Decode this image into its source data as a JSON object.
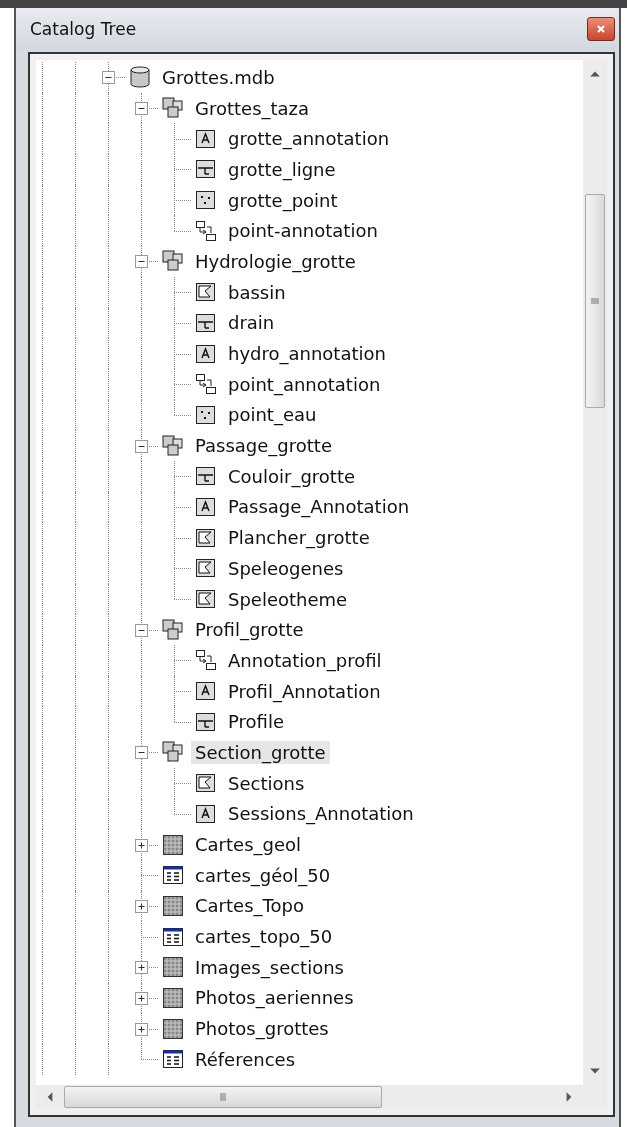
{
  "window": {
    "title": "Catalog Tree"
  },
  "tree": [
    {
      "label": "Grottes.mdb",
      "kind": "database",
      "expanded": true,
      "selected": false,
      "children": [
        {
          "label": "Grottes_taza",
          "kind": "dataset",
          "expanded": true,
          "selected": false,
          "children": [
            {
              "label": "grotte_annotation",
              "kind": "annotation",
              "selected": false
            },
            {
              "label": "grotte_ligne",
              "kind": "line",
              "selected": false
            },
            {
              "label": "grotte_point",
              "kind": "point",
              "selected": false
            },
            {
              "label": "point-annotation",
              "kind": "relationship",
              "selected": false
            }
          ]
        },
        {
          "label": "Hydrologie_grotte",
          "kind": "dataset",
          "expanded": true,
          "selected": false,
          "children": [
            {
              "label": "bassin",
              "kind": "polygon",
              "selected": false
            },
            {
              "label": "drain",
              "kind": "line",
              "selected": false
            },
            {
              "label": "hydro_annotation",
              "kind": "annotation",
              "selected": false
            },
            {
              "label": "point_annotation",
              "kind": "relationship",
              "selected": false
            },
            {
              "label": "point_eau",
              "kind": "point",
              "selected": false
            }
          ]
        },
        {
          "label": "Passage_grotte",
          "kind": "dataset",
          "expanded": true,
          "selected": false,
          "children": [
            {
              "label": "Couloir_grotte",
              "kind": "line",
              "selected": false
            },
            {
              "label": "Passage_Annotation",
              "kind": "annotation",
              "selected": false
            },
            {
              "label": "Plancher_grotte",
              "kind": "polygon",
              "selected": false
            },
            {
              "label": "Speleogenes",
              "kind": "polygon",
              "selected": false
            },
            {
              "label": "Speleotheme",
              "kind": "polygon",
              "selected": false
            }
          ]
        },
        {
          "label": "Profil_grotte",
          "kind": "dataset",
          "expanded": true,
          "selected": false,
          "children": [
            {
              "label": "Annotation_profil",
              "kind": "relationship",
              "selected": false
            },
            {
              "label": "Profil_Annotation",
              "kind": "annotation",
              "selected": false
            },
            {
              "label": "Profile",
              "kind": "line",
              "selected": false
            }
          ]
        },
        {
          "label": "Section_grotte",
          "kind": "dataset",
          "expanded": true,
          "selected": true,
          "children": [
            {
              "label": "Sections",
              "kind": "polygon",
              "selected": false
            },
            {
              "label": "Sessions_Annotation",
              "kind": "annotation",
              "selected": false
            }
          ]
        },
        {
          "label": "Cartes_geol",
          "kind": "raster",
          "expanded": false,
          "selected": false
        },
        {
          "label": "cartes_géol_50",
          "kind": "table",
          "selected": false
        },
        {
          "label": "Cartes_Topo",
          "kind": "raster",
          "expanded": false,
          "selected": false
        },
        {
          "label": "cartes_topo_50",
          "kind": "table",
          "selected": false
        },
        {
          "label": "Images_sections",
          "kind": "raster",
          "expanded": false,
          "selected": false
        },
        {
          "label": "Photos_aeriennes",
          "kind": "raster",
          "expanded": false,
          "selected": false
        },
        {
          "label": "Photos_grottes",
          "kind": "raster",
          "expanded": false,
          "selected": false
        },
        {
          "label": "Réferences",
          "kind": "table",
          "selected": false
        }
      ]
    }
  ]
}
